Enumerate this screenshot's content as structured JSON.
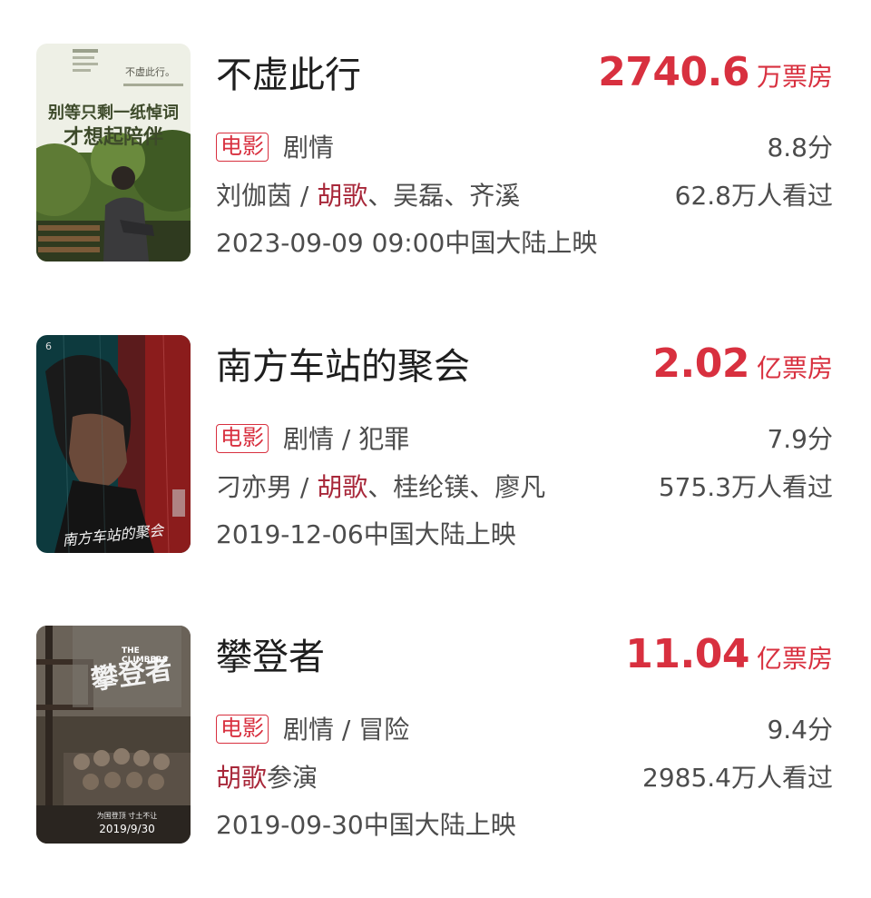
{
  "colors": {
    "accent": "#d8303f",
    "highlight": "#a8283a",
    "text": "#4c4c4c",
    "title": "#1e1e1e"
  },
  "movies": [
    {
      "title": "不虚此行",
      "box_number": "2740.6",
      "box_unit": "万票房",
      "type_badge": "电影",
      "genres": "剧情",
      "rating": "8.8分",
      "cast_prefix": "刘伽茵 / ",
      "cast_highlight": "胡歌",
      "cast_suffix": "、吴磊、齐溪",
      "viewers": "62.8万人看过",
      "release": "2023-09-09 09:00中国大陆上映",
      "poster_text": {
        "top_title": "不虚此行。",
        "line1": "别等只剩一纸悼词",
        "line2": "才想起陪伴"
      }
    },
    {
      "title": "南方车站的聚会",
      "box_number": "2.02",
      "box_unit": "亿票房",
      "type_badge": "电影",
      "genres": "剧情 / 犯罪",
      "rating": "7.9分",
      "cast_prefix": "刁亦男 / ",
      "cast_highlight": "胡歌",
      "cast_suffix": "、桂纶镁、廖凡",
      "viewers": "575.3万人看过",
      "release": "2019-12-06中国大陆上映",
      "poster_text": {
        "corner": "6",
        "title": "南方车站的聚会"
      }
    },
    {
      "title": "攀登者",
      "box_number": "11.04",
      "box_unit": "亿票房",
      "type_badge": "电影",
      "genres": "剧情 / 冒险",
      "rating": "9.4分",
      "cast_prefix": "",
      "cast_highlight": "胡歌",
      "cast_suffix": "参演",
      "viewers": "2985.4万人看过",
      "release": "2019-09-30中国大陆上映",
      "poster_text": {
        "title": "攀登者",
        "en_line1": "THE",
        "en_line2": "CLIMBERS",
        "slogan": "为国登顶 寸土不让",
        "date": "2019/9/30"
      }
    }
  ]
}
